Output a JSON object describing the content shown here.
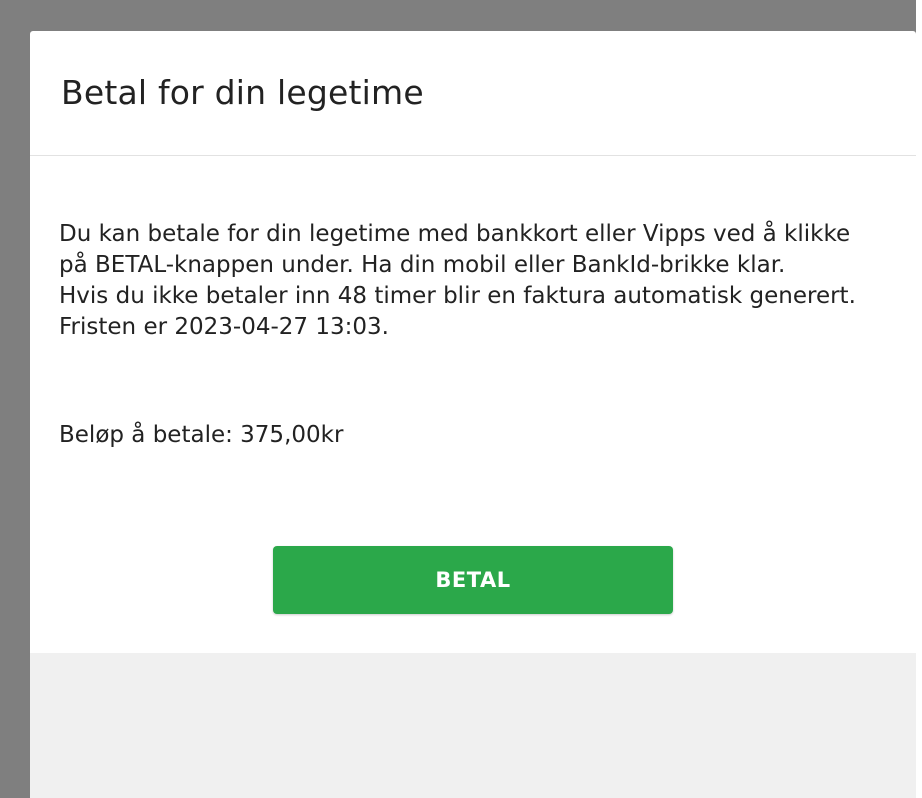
{
  "modal": {
    "title": "Betal for din legetime",
    "description_lines": [
      "Du kan betale for din legetime med bankkort eller Vipps ved å klikke på BETAL-knappen under. Ha din mobil eller BankId-brikke klar.",
      "Hvis du ikke betaler inn 48 timer blir en faktura automatisk generert. Fristen er 2023-04-27 13:03."
    ],
    "amount_text": "Beløp å betale: 375,00kr",
    "pay_button_label": "BETAL"
  },
  "colors": {
    "primary_button": "#2ba84a",
    "backdrop": "#7f7f7f",
    "footer": "#f0f0f0"
  }
}
